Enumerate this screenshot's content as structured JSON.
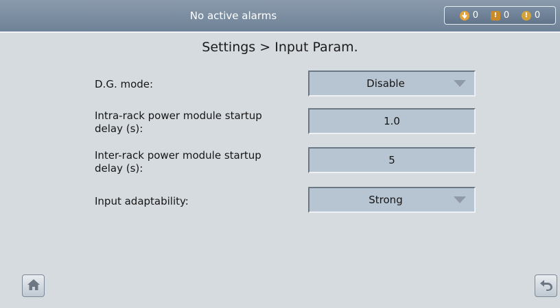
{
  "status_bar": {
    "alarm_message": "No active alarms",
    "counts": {
      "minor": "0",
      "major": "0",
      "critical": "0"
    }
  },
  "breadcrumb": "Settings > Input Param.",
  "settings": [
    {
      "label": "D.G. mode:",
      "value": "Disable",
      "type": "dropdown"
    },
    {
      "label_lines": [
        "Intra-rack power module startup",
        "delay (s):"
      ],
      "value": "1.0",
      "type": "input"
    },
    {
      "label_lines": [
        "Inter-rack power module startup",
        "delay (s):"
      ],
      "value": "5",
      "type": "input"
    },
    {
      "label": "Input adaptability:",
      "value": "Strong",
      "type": "dropdown"
    }
  ],
  "icons": {
    "home": "home-icon",
    "back": "back-icon"
  }
}
